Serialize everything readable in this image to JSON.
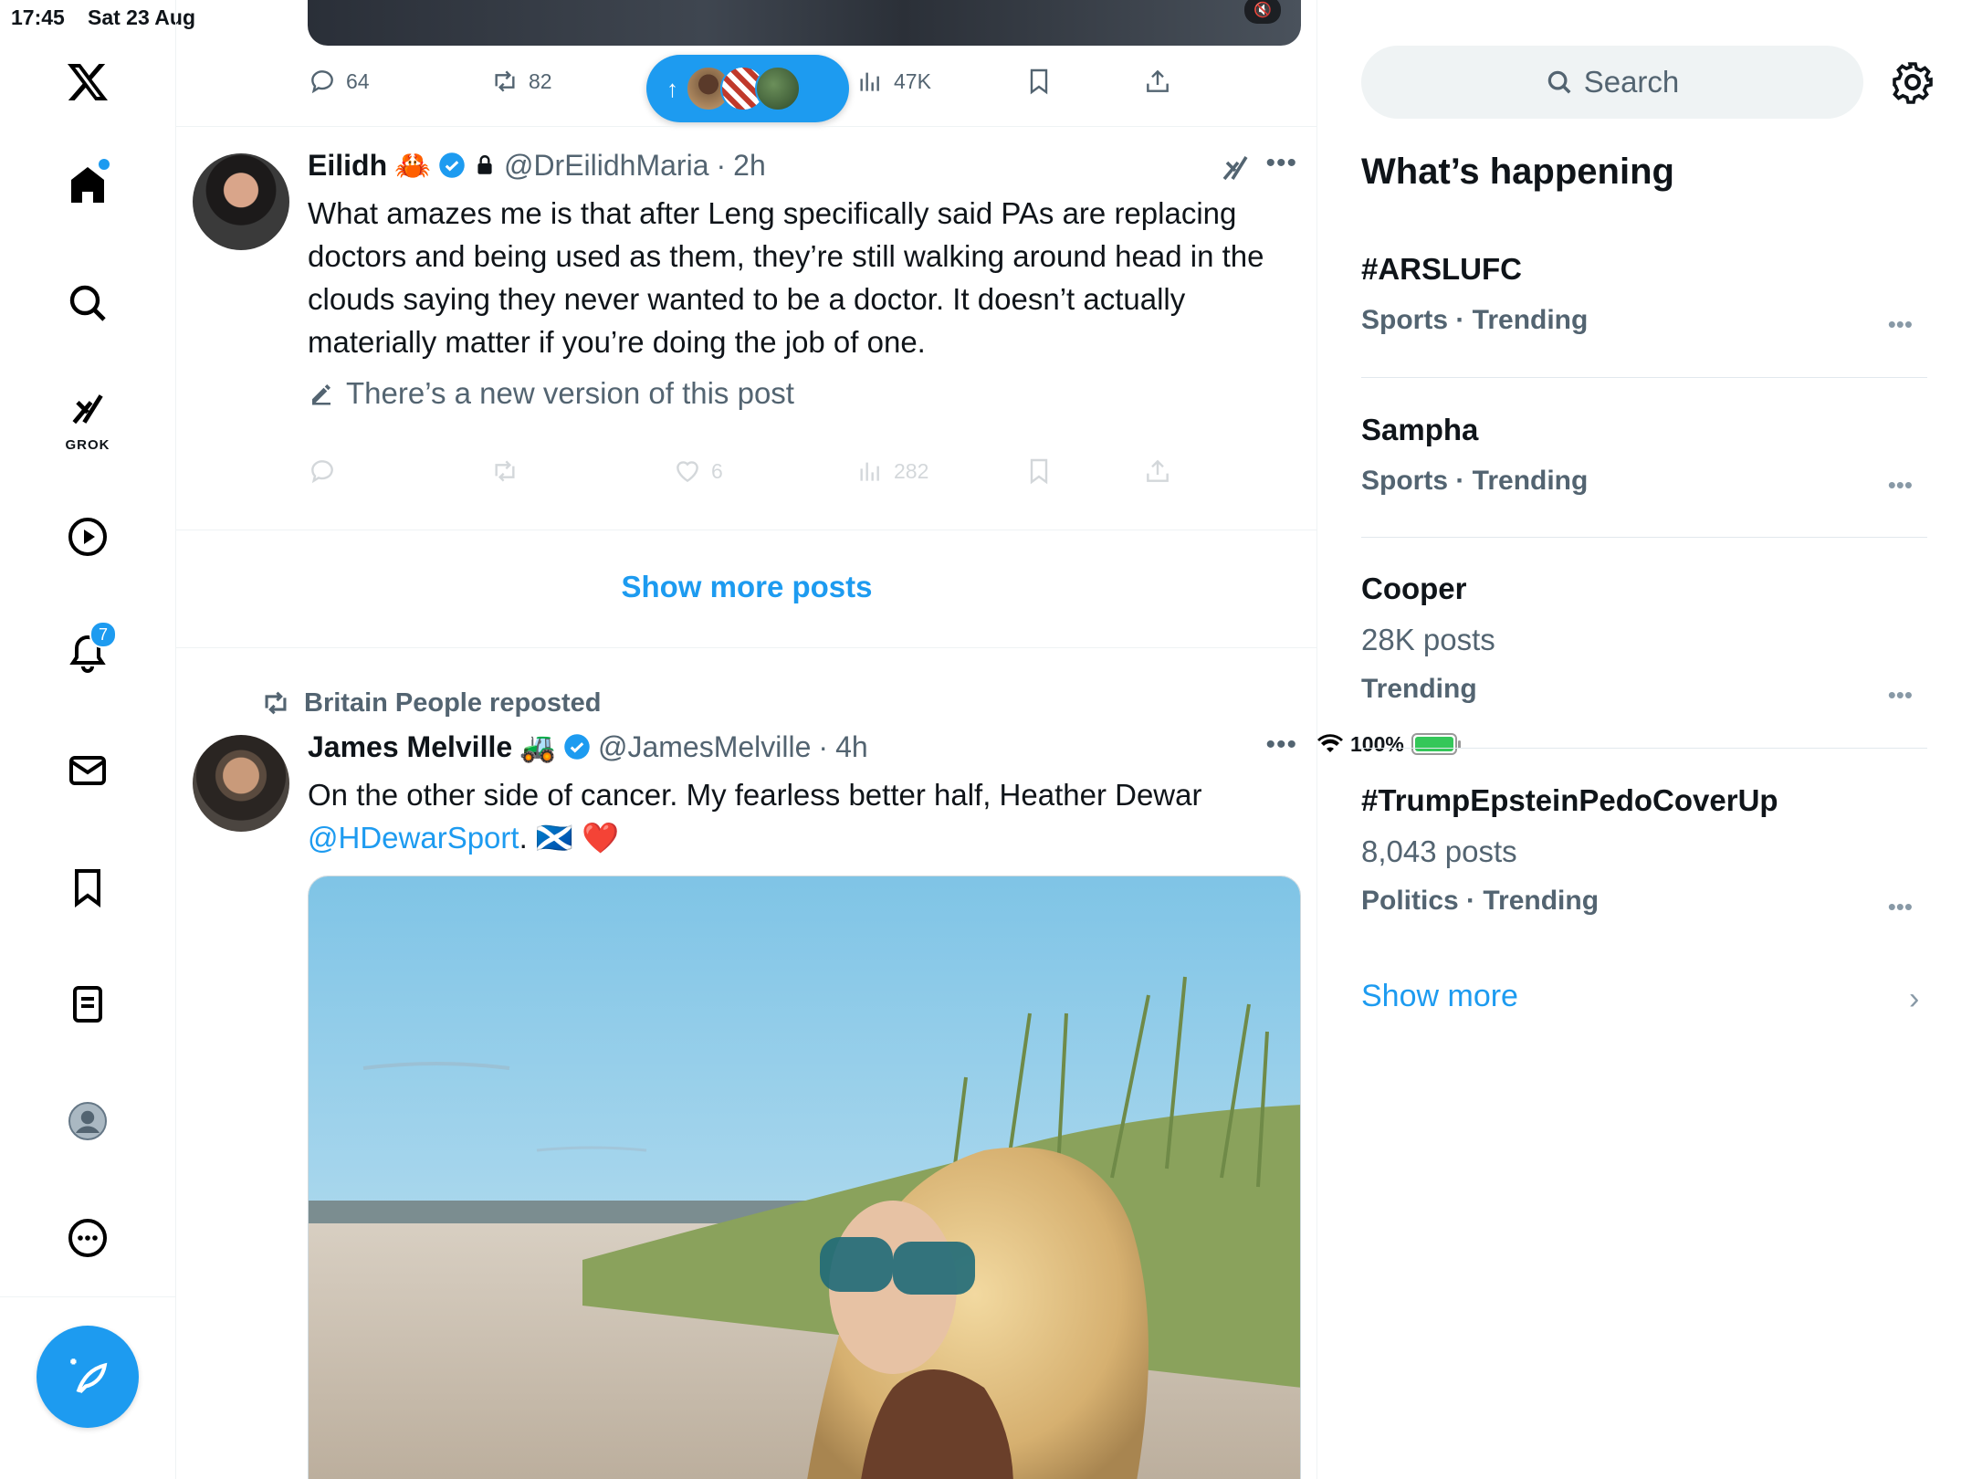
{
  "status_bar": {
    "time": "17:45",
    "date": "Sat 23 Aug",
    "battery": "100%"
  },
  "nav": {
    "grok_label": "GROK",
    "notifications_count": "7"
  },
  "prev_tweet": {
    "replies": "64",
    "reposts": "82",
    "views": "47K"
  },
  "tweet1": {
    "name": "Eilidh",
    "emoji": "🦀",
    "handle": "@DrEilidhMaria",
    "sep": "·",
    "time": "2h",
    "text": "What amazes me is that after Leng specifically said PAs are replacing doctors and being used as them, they’re still walking around head in the clouds saying they never wanted to be a doctor. It doesn’t actually materially matter if you’re doing the job of one.",
    "new_version": "There’s a new version of this post",
    "likes": "6",
    "views": "282"
  },
  "show_more_posts": "Show more posts",
  "tweet2": {
    "reposted_by": "Britain People reposted",
    "name": "James Melville",
    "emoji": "🚜",
    "handle": "@JamesMelville",
    "sep": "·",
    "time": "4h",
    "text_main": "On the other side of cancer. My fearless better half, Heather Dewar",
    "mention": "@HDewarSport",
    "text_end": ". 🏴󠁧󠁢󠁳󠁣󠁴󠁿 ❤️"
  },
  "sidebar": {
    "search_placeholder": "Search",
    "whats_happening": "What’s happening",
    "trends": [
      {
        "topic": "#ARSLUFC",
        "meta": "Sports · Trending",
        "count": ""
      },
      {
        "topic": "Sampha",
        "meta": "Sports · Trending",
        "count": ""
      },
      {
        "topic": "Cooper",
        "count": "28K posts",
        "meta": "Trending"
      },
      {
        "topic": "#TrumpEpsteinPedoCoverUp",
        "count": "8,043 posts",
        "meta": "Politics · Trending"
      }
    ],
    "show_more": "Show more"
  },
  "colors": {
    "accent": "#1d9bf0",
    "text": "#0f1419",
    "secondary": "#536471"
  }
}
